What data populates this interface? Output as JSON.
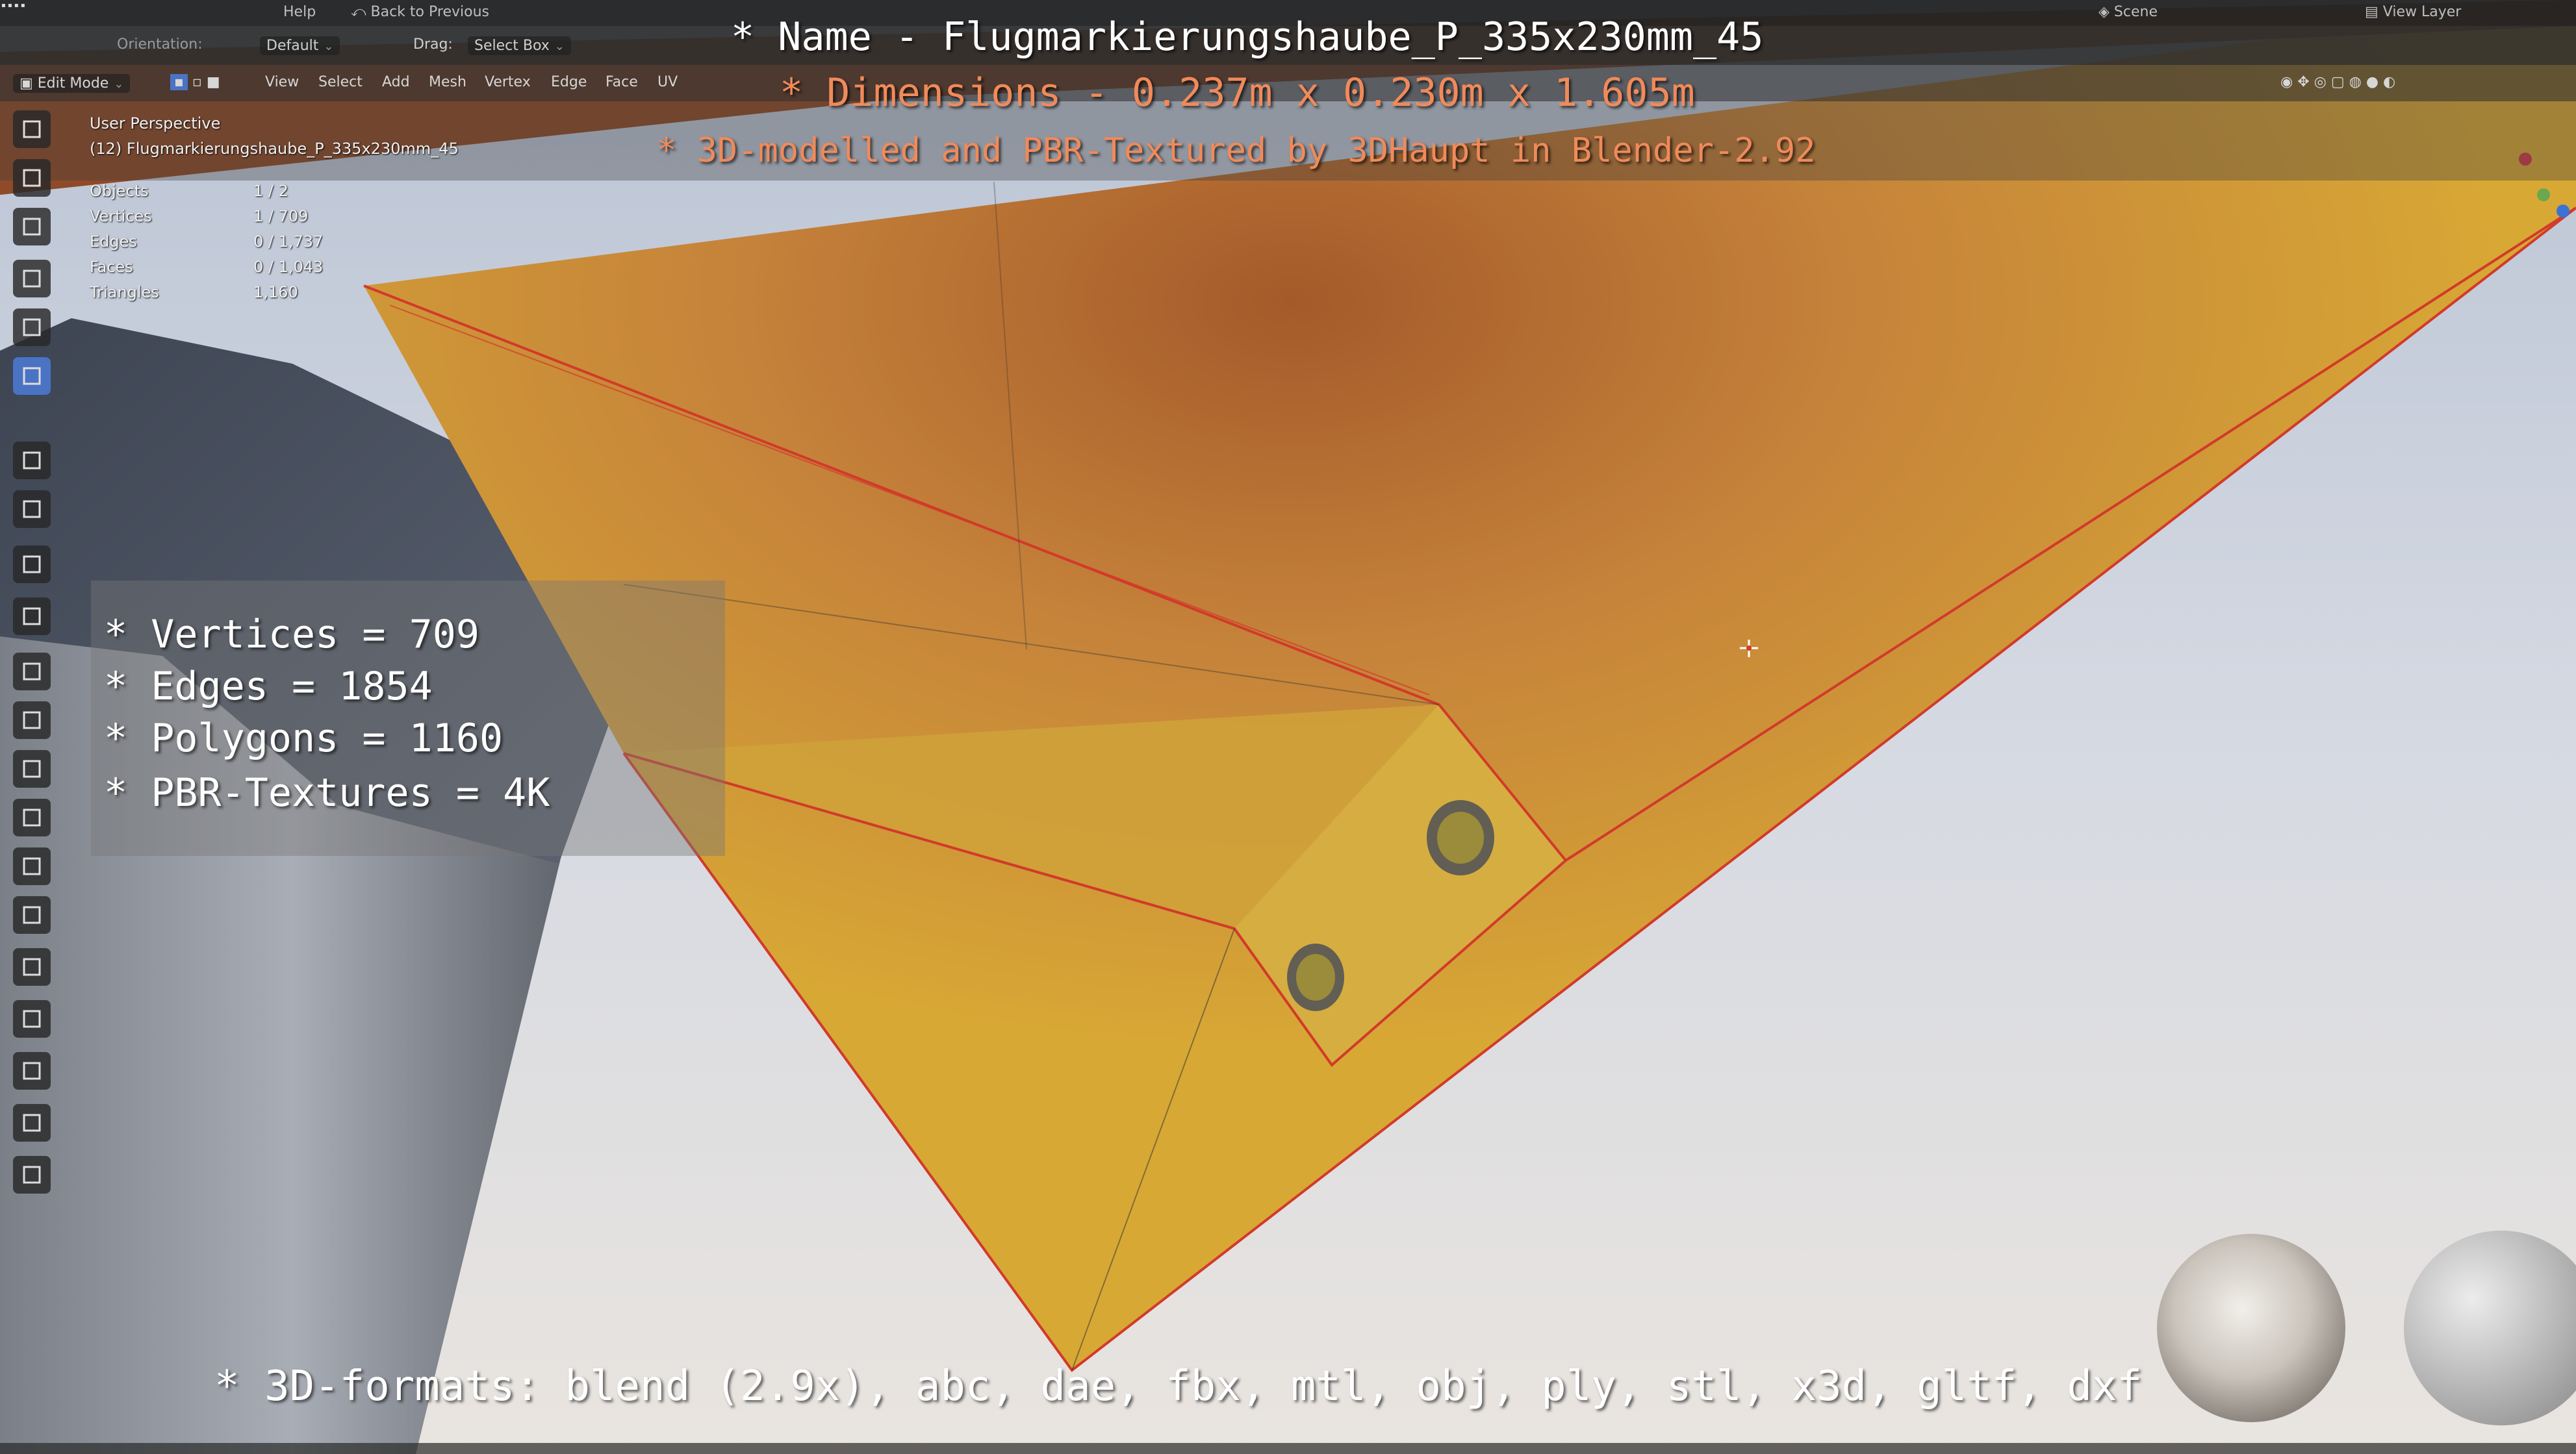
{
  "menu": {
    "items": [
      "Help"
    ],
    "back_button": "Back to Previous",
    "scene_label": "Scene",
    "view_layer_label": "View Layer"
  },
  "header": {
    "orientation_label": "Orientation:",
    "orientation_value": "Default",
    "drag_label": "Drag:",
    "drag_value": "Select Box"
  },
  "modebar": {
    "mode": "Edit Mode",
    "menus": [
      "View",
      "Select",
      "Add",
      "Mesh",
      "Vertex",
      "Edge",
      "Face",
      "UV"
    ]
  },
  "viewport_info": {
    "perspective": "User Perspective",
    "object_name": "(12) Flugmarkierungshaube_P_335x230mm_45",
    "stats": [
      {
        "label": "Objects",
        "value": "1 / 2"
      },
      {
        "label": "Vertices",
        "value": "1 / 709"
      },
      {
        "label": "Edges",
        "value": "0 / 1,737"
      },
      {
        "label": "Faces",
        "value": "0 / 1,043"
      },
      {
        "label": "Triangles",
        "value": "1,160"
      }
    ]
  },
  "overlay": {
    "name_line": "* Name - Flugmarkierungshaube_P_335x230mm_45",
    "dimensions_line": "* Dimensions -  0.237m x 0.230m x 1.605m",
    "credit_line": "* 3D-modelled and PBR-Textured by 3DHaupt in Blender-2.92",
    "info": [
      "* Vertices = 709",
      "* Edges = 1854",
      "* Polygons = 1160",
      "* PBR-Textures = 4K"
    ],
    "formats_line": "* 3D-formats: blend (2.9x), abc, dae, fbx, mtl, obj, ply, stl, x3d, gltf, dxf"
  },
  "colors": {
    "title_white": "#ffffff",
    "title_orange": "#f08a5a",
    "active_tool": "#4a73c4",
    "object_yellow": "#d8a835",
    "edge_red": "#d23a2a"
  },
  "tools": [
    "select-box-icon",
    "cursor-icon",
    "move-icon",
    "rotate-icon",
    "scale-icon",
    "transform-icon",
    "annotate-icon",
    "measure-icon",
    "add-cube-icon",
    "extrude-region-icon",
    "inset-faces-icon",
    "bevel-icon",
    "loop-cut-icon",
    "knife-icon",
    "poly-build-icon",
    "spin-icon",
    "smooth-icon",
    "edge-slide-icon",
    "shrink-fatten-icon",
    "shear-icon",
    "rip-region-icon"
  ]
}
